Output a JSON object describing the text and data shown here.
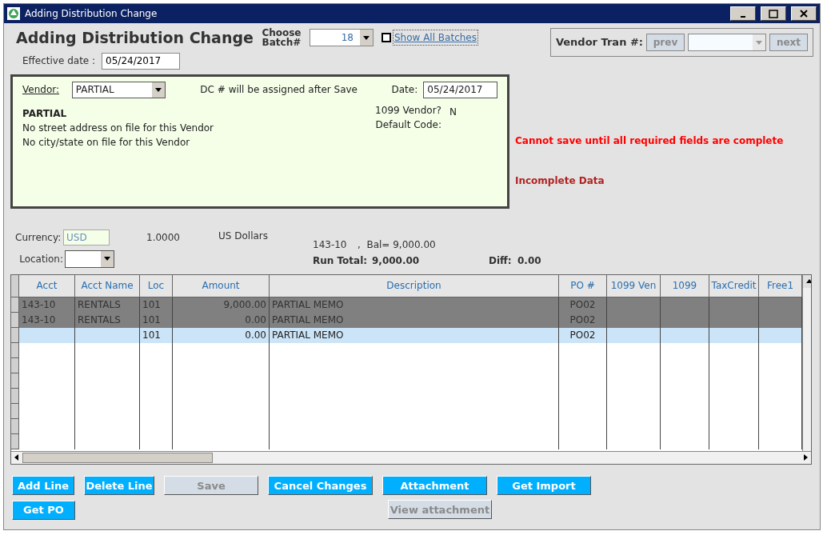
{
  "window": {
    "title": "Adding Distribution Change"
  },
  "header": {
    "title": "Adding Distribution Change",
    "batch_label": "Choose Batch#",
    "batch_value": "18",
    "show_all": {
      "label": "Show All Batches",
      "checked": false
    },
    "vendor_tran_label": "Vendor Tran #:",
    "prev": {
      "label": "prev",
      "enabled": false
    },
    "next": {
      "label": "next",
      "enabled": false
    }
  },
  "effective_date": {
    "label": "Effective date :",
    "value": "05/24/2017"
  },
  "vendor_panel": {
    "vendor_label": "Vendor:",
    "vendor_value": "PARTIAL",
    "dc_note": "DC # will be assigned after Save",
    "date_label": "Date:",
    "date_value": "05/24/2017",
    "name": "PARTIAL",
    "address_lines": [
      "No street address on file for this Vendor",
      "No city/state on file for this Vendor"
    ],
    "v1099_label": "1099 Vendor?",
    "v1099_value": "N",
    "default_code_label": "Default Code:"
  },
  "messages": [
    {
      "text": "Cannot save until all required fields are complete",
      "color": "#ff0000"
    },
    {
      "text": "Incomplete Data",
      "color": "#b22222"
    }
  ],
  "currency": {
    "label": "Currency:",
    "value": "USD",
    "rate": "1.0000",
    "name": "US Dollars"
  },
  "location": {
    "label": "Location:"
  },
  "balance": {
    "account": "143-10",
    "bal": ",  Bal= 9,000.00",
    "run_total_label": "Run Total:",
    "run_total": "9,000.00",
    "diff_label": "Diff:",
    "diff": "0.00"
  },
  "table": {
    "columns": [
      "Acct",
      "Acct Name",
      "Loc",
      "Amount",
      "Description",
      "PO #",
      "1099 Ven",
      "1099",
      "TaxCredit",
      "Free1"
    ],
    "rows": [
      {
        "cells": [
          "143-10",
          "RENTALS",
          "101",
          "9,000.00",
          "PARTIAL MEMO",
          "PO02",
          "",
          "",
          "",
          ""
        ],
        "locked": true,
        "selected": false
      },
      {
        "cells": [
          "143-10",
          "RENTALS",
          "101",
          "0.00",
          "PARTIAL MEMO",
          "PO02",
          "",
          "",
          "",
          ""
        ],
        "locked": true,
        "selected": false
      },
      {
        "cells": [
          "",
          "",
          "101",
          "0.00",
          "PARTIAL MEMO",
          "PO02",
          "",
          "",
          "",
          ""
        ],
        "locked": false,
        "selected": true
      }
    ]
  },
  "buttons": [
    [
      {
        "label": "Add Line",
        "enabled": true
      },
      {
        "label": "Delete Line",
        "enabled": true
      },
      {
        "label": "Save",
        "enabled": false
      },
      {
        "label": "Cancel Changes",
        "enabled": true
      },
      {
        "label": "Attachment",
        "enabled": true
      },
      {
        "label": "Get Import",
        "enabled": true
      }
    ],
    [
      {
        "label": "Get PO",
        "enabled": true
      },
      {
        "label": "View attachment",
        "enabled": false
      }
    ]
  ]
}
